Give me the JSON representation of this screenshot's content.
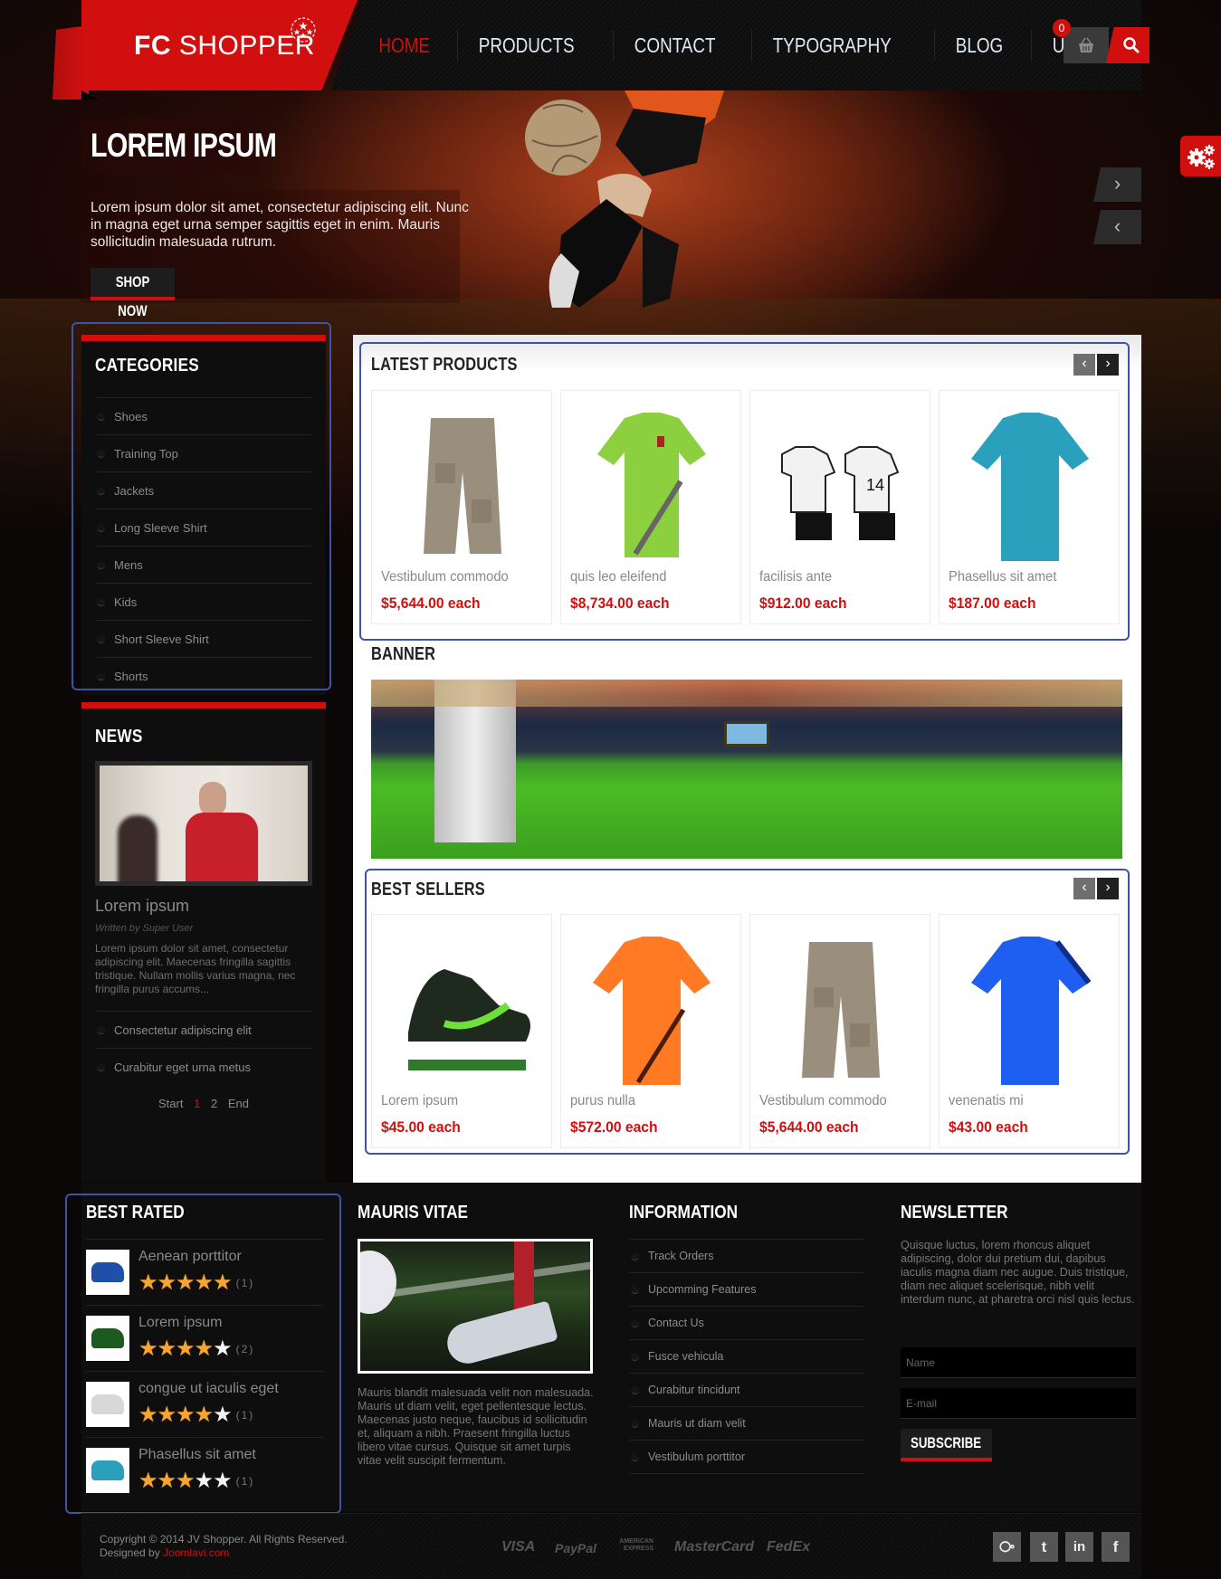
{
  "brand": {
    "name_bold": "FC",
    "name_rest": "SHOPPER",
    "accent": "#d20f0f"
  },
  "nav": {
    "items": [
      {
        "label": "HOME",
        "active": true
      },
      {
        "label": "PRODUCTS",
        "active": false
      },
      {
        "label": "CONTACT",
        "active": false
      },
      {
        "label": "TYPOGRAPHY",
        "active": false
      },
      {
        "label": "BLOG",
        "active": false
      },
      {
        "label": "USER",
        "active": false
      }
    ],
    "cart_count": "0",
    "cart_icon": "basket-icon",
    "search_icon": "search-icon"
  },
  "hero": {
    "title": "LOREM IPSUM",
    "description": "Lorem ipsum dolor sit amet, consectetur adipiscing elit. Nunc in magna eget urna semper sagittis eget in enim. Mauris sollicitudin malesuada rutrum.",
    "cta_label": "SHOP NOW",
    "next_label": "›",
    "prev_label": "‹"
  },
  "settings": {
    "icon": "gears-icon"
  },
  "categories": {
    "title": "CATEGORIES",
    "items": [
      "Shoes",
      "Training Top",
      "Jackets",
      "Long Sleeve Shirt",
      "Mens",
      "Kids",
      "Short Sleeve Shirt",
      "Shorts"
    ]
  },
  "news": {
    "title": "NEWS",
    "article_title": "Lorem ipsum",
    "author": "Written by Super User",
    "excerpt": "Lorem ipsum dolor sit amet, consectetur adipiscing elit. Maecenas fringilla sagittis tristique. Nullam mollis varius magna, nec fringilla purus accums...",
    "links": [
      "Consectetur adipiscing elit",
      "Curabitur eget urna metus"
    ],
    "pagination": {
      "start": "Start",
      "pages": [
        "1",
        "2"
      ],
      "current": "1",
      "end": "End"
    }
  },
  "latest_products": {
    "title": "LATEST PRODUCTS",
    "prev": "‹",
    "next": "›",
    "items": [
      {
        "name": "Vestibulum commodo",
        "price": "$5,644.00 each",
        "image": "cargo-shorts"
      },
      {
        "name": "quis leo eleifend",
        "price": "$8,734.00 each",
        "image": "green-jersey"
      },
      {
        "name": "facilisis ante",
        "price": "$912.00 each",
        "image": "kids-kit"
      },
      {
        "name": "Phasellus sit amet",
        "price": "$187.00 each",
        "image": "teal-shirt"
      }
    ]
  },
  "banner": {
    "title": "BANNER",
    "image": "stadium"
  },
  "best_sellers": {
    "title": "BEST SELLERS",
    "prev": "‹",
    "next": "›",
    "items": [
      {
        "name": "Lorem ipsum",
        "price": "$45.00 each",
        "image": "green-sneaker"
      },
      {
        "name": "purus nulla",
        "price": "$572.00 each",
        "image": "orange-jersey"
      },
      {
        "name": "Vestibulum commodo",
        "price": "$5,644.00 each",
        "image": "cargo-shorts"
      },
      {
        "name": "venenatis mi",
        "price": "$43.00 each",
        "image": "blue-shirt"
      }
    ]
  },
  "best_rated": {
    "title": "BEST RATED",
    "items": [
      {
        "name": "Aenean porttitor",
        "rating": 5,
        "max": 5,
        "count": "(1)"
      },
      {
        "name": "Lorem ipsum",
        "rating": 4,
        "max": 5,
        "count": "(2)"
      },
      {
        "name": "congue ut iaculis eget",
        "rating": 4,
        "max": 5,
        "count": "(1)"
      },
      {
        "name": "Phasellus sit amet",
        "rating": 3,
        "max": 5,
        "count": "(1)"
      }
    ]
  },
  "mauris_vitae": {
    "title": "MAURIS VITAE",
    "text": "Mauris blandit malesuada velit non malesuada. Mauris ut diam velit, eget pellentesque lectus. Maecenas justo neque, faucibus id sollicitudin et, aliquam a nibh. Praesent fringilla luctus libero vitae cursus. Quisque sit amet turpis vitae velit suscipit fermentum."
  },
  "information": {
    "title": "INFORMATION",
    "items": [
      "Track Orders",
      "Upcomming Features",
      "Contact Us",
      "Fusce vehicula",
      "Curabitur tincidunt",
      "Mauris ut diam velit",
      "Vestibulum porttitor"
    ]
  },
  "newsletter": {
    "title": "NEWSLETTER",
    "text": "Quisque luctus, lorem rhoncus aliquet adipiscing, dolor dui pretium dui, dapibus iaculis magna diam nec augue. Duis tristique, diam nec aliquet scelerisque, nibh velit interdum nunc, at pharetra orci nisl quis lectus.",
    "name_placeholder": "Name",
    "email_placeholder": "E-mail",
    "subscribe_label": "SUBSCRIBE"
  },
  "footer": {
    "copyright": "Copyright © 2014 JV Shopper. All Rights Reserved.",
    "designed_by": "Designed by",
    "designer_link": "Joomlavi.com",
    "payments": [
      "VISA",
      "PayPal",
      "AMERICAN EXPRESS",
      "MasterCard",
      "FedEx"
    ],
    "social": [
      {
        "name": "rss",
        "glyph": "⧂"
      },
      {
        "name": "twitter",
        "glyph": "t"
      },
      {
        "name": "linkedin",
        "glyph": "in"
      },
      {
        "name": "facebook",
        "glyph": "f"
      }
    ]
  }
}
